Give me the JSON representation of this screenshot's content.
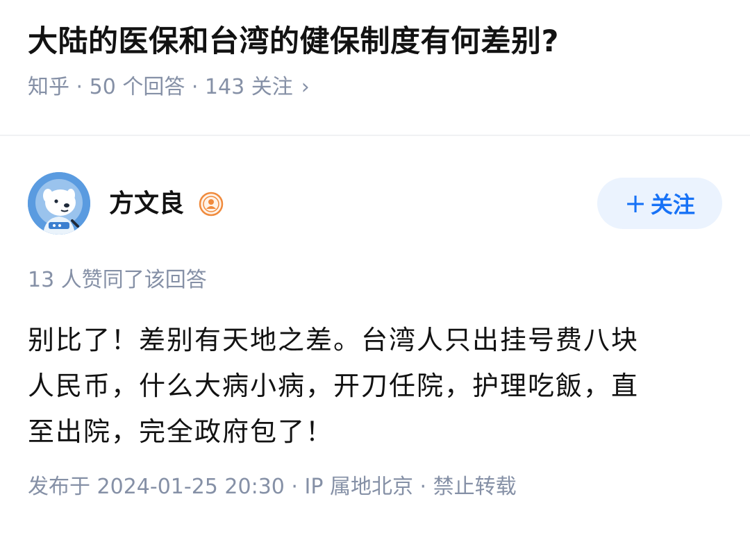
{
  "question": {
    "title": "大陆的医保和台湾的健保制度有何差别?",
    "meta": "知乎 · 50 个回答 · 143 关注",
    "chevron_icon": "chevron-right-icon"
  },
  "author": {
    "name": "方文良",
    "avatar_icon": "astronaut-dog-avatar",
    "badge_icon": "user-badge-icon",
    "follow_label": "关注",
    "follow_prefix": "+"
  },
  "answer": {
    "agree_text": "13 人赞同了该回答",
    "lines": [
      "别比了！差别有天地之差。台湾人只出挂号费八块",
      "人民币，什么大病小病，开刀任院，护理吃飯，直",
      "至出院，完全政府包了！"
    ],
    "footer": "发布于 2024-01-25 20:30 · IP 属地北京 · 禁止转载"
  },
  "colors": {
    "accent": "#1772f6",
    "follow_bg": "#ebf3fe",
    "meta_gray": "#8590a6",
    "badge_orange": "#f08a3c"
  }
}
